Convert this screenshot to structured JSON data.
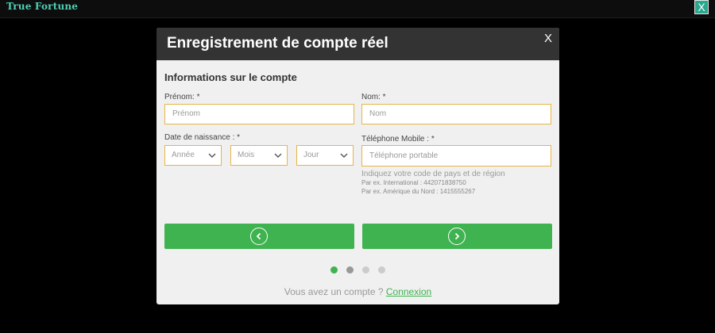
{
  "app": {
    "brand": "True Fortune",
    "close_label": "X"
  },
  "modal": {
    "title": "Enregistrement de compte réel",
    "close_label": "X",
    "section_title": "Informations sur le compte",
    "fields": {
      "prenom_label": "Prénom: *",
      "prenom_placeholder": "Prénom",
      "nom_label": "Nom: *",
      "nom_placeholder": "Nom",
      "dob_label": "Date de naissance : *",
      "year": "Année",
      "month": "Mois",
      "day": "Jour",
      "phone_label": "Téléphone Mobile : *",
      "phone_placeholder": "Téléphone portable",
      "phone_hint": "Indiquez votre code de pays et de région",
      "phone_example_intl": "Par ex. International : 442071838750",
      "phone_example_na": "Par ex. Amérique du Nord : 1415555267"
    },
    "steps": {
      "count": 4,
      "active_index": 1
    },
    "footer": {
      "prompt": "Vous avez un compte ?",
      "link": "Connexion"
    }
  },
  "colors": {
    "accent": "#3fb350",
    "input_border": "#e6b545",
    "header_bg": "#333333",
    "dot_active": "#3fb350",
    "dot_mid": "#999999",
    "dot_inactive": "#cccccc"
  }
}
